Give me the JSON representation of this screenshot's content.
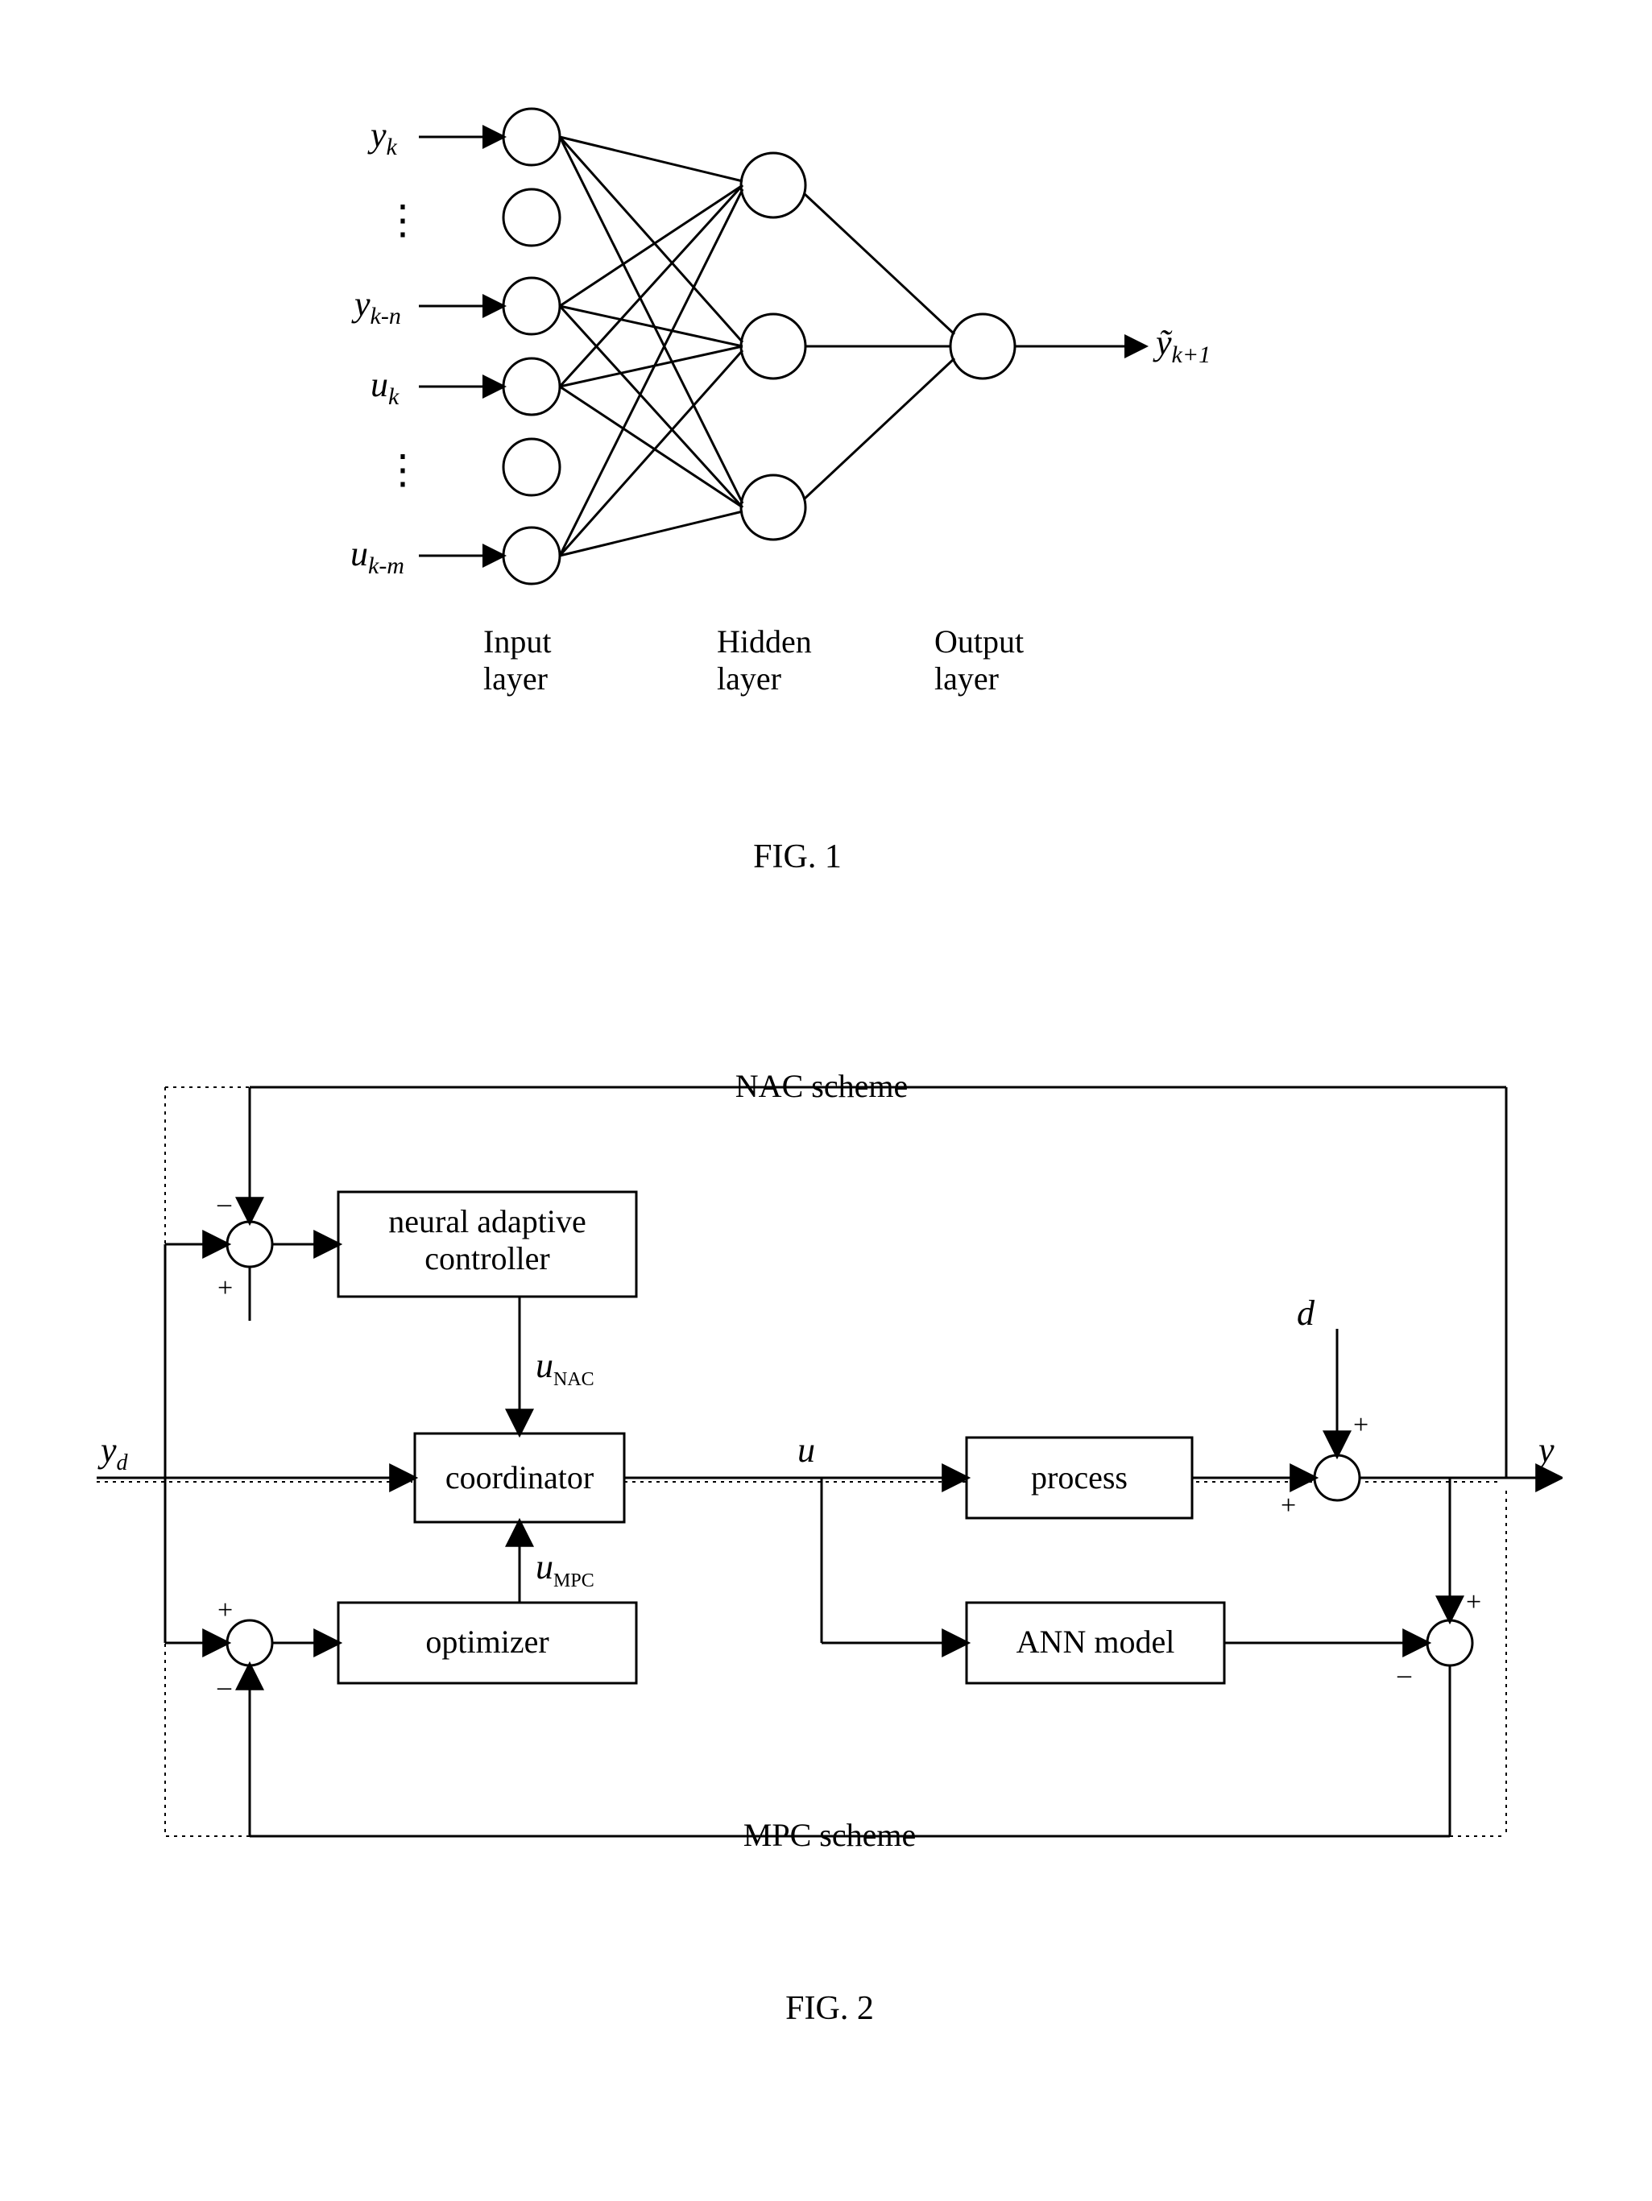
{
  "fig1": {
    "inputs": {
      "y_k": "y",
      "y_k_sub": "k",
      "dots1": "⋮",
      "y_kn": "y",
      "y_kn_sub": "k-n",
      "u_k": "u",
      "u_k_sub": "k",
      "dots2": "⋮",
      "u_km": "u",
      "u_km_sub": "k-m"
    },
    "output": "ỹ",
    "output_sub": "k+1",
    "layers": {
      "input": "Input\nlayer",
      "hidden": "Hidden\nlayer",
      "output": "Output\nlayer"
    },
    "caption": "FIG. 1"
  },
  "fig2": {
    "title_top": "NAC scheme",
    "title_bottom": "MPC scheme",
    "blocks": {
      "nac": "neural adaptive\ncontroller",
      "coord": "coordinator",
      "opt": "optimizer",
      "process": "process",
      "ann": "ANN model"
    },
    "signals": {
      "yd": "y",
      "yd_sub": "d",
      "u_nac": "u",
      "u_nac_sub": "NAC",
      "u_mpc": "u",
      "u_mpc_sub": "MPC",
      "u": "u",
      "d": "d",
      "y": "y"
    },
    "signs": {
      "plus": "+",
      "minus": "–"
    },
    "caption": "FIG. 2"
  }
}
